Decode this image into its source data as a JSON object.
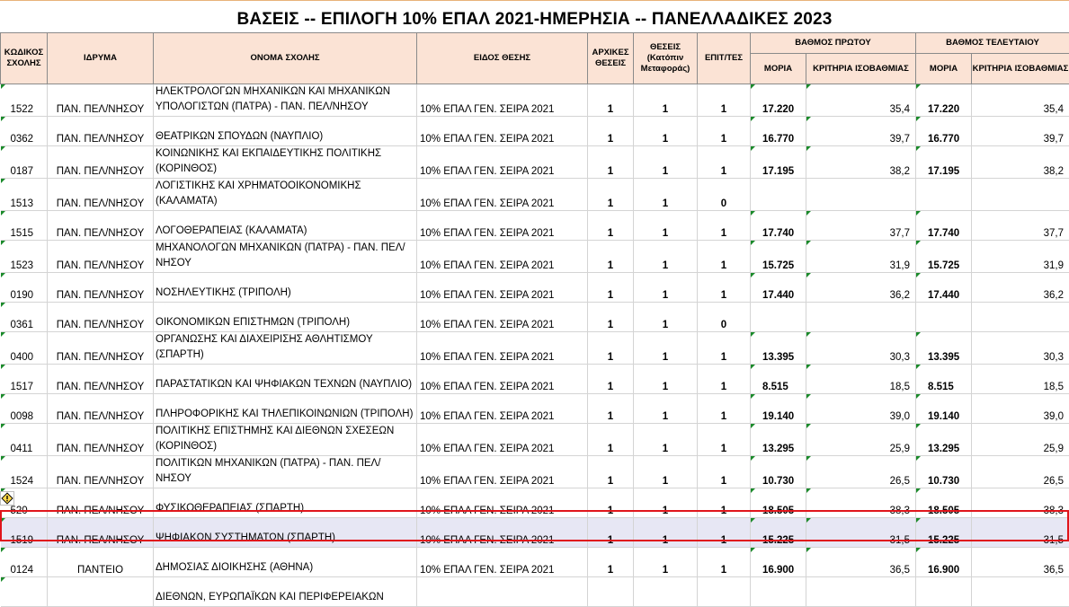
{
  "title": "ΒΑΣΕΙΣ -- ΕΠΙΛΟΓΗ 10% ΕΠΑΛ 2021-ΗΜΕΡΗΣΙΑ -- ΠΑΝΕΛΛΑΔΙΚΕΣ 2023",
  "headers": {
    "code": "ΚΩΔΙΚΟΣ ΣΧΟΛΗΣ",
    "institution": "ΙΔΡΥΜΑ",
    "school": "ΟΝΟΜΑ ΣΧΟΛΗΣ",
    "type": "ΕΙΔΟΣ ΘΕΣΗΣ",
    "initial": "ΑΡΧΙΚΕΣ ΘΕΣΕΙΣ",
    "after": "ΘΕΣΕΙΣ (Κατόπιν Μεταφοράς)",
    "passed": "ΕΠΙΤ/ΤΕΣ",
    "first_group": "ΒΑΘΜΟΣ ΠΡΩΤΟΥ",
    "last_group": "ΒΑΘΜΟΣ ΤΕΛΕΥΤΑΙΟΥ",
    "moria": "ΜΟΡΙΑ",
    "criteria": "ΚΡΙΤΗΡΙΑ ΙΣΟΒΑΘΜΙΑΣ"
  },
  "rows": [
    {
      "code": "1522",
      "inst": "ΠΑΝ. ΠΕΛ/ΝΗΣΟΥ",
      "name": "ΗΛΕΚΤΡΟΛΟΓΩΝ ΜΗΧΑΝΙΚΩΝ ΚΑΙ ΜΗΧΑΝΙΚΩΝ ΥΠΟΛΟΓΙΣΤΩΝ (ΠΑΤΡΑ) - ΠΑΝ. ΠΕΛ/ΝΗΣΟΥ",
      "type": "10% ΕΠΑΛ ΓΕΝ. ΣΕΙΡΑ 2021",
      "initial": "1",
      "after": "1",
      "passed": "1",
      "m1": "17.220",
      "c1": "35,4",
      "m2": "17.220",
      "c2": "35,4"
    },
    {
      "code": "0362",
      "inst": "ΠΑΝ. ΠΕΛ/ΝΗΣΟΥ",
      "name": "ΘΕΑΤΡΙΚΩΝ ΣΠΟΥΔΩΝ (ΝΑΥΠΛΙΟ)",
      "type": "10% ΕΠΑΛ ΓΕΝ. ΣΕΙΡΑ 2021",
      "initial": "1",
      "after": "1",
      "passed": "1",
      "m1": "16.770",
      "c1": "39,7",
      "m2": "16.770",
      "c2": "39,7"
    },
    {
      "code": "0187",
      "inst": "ΠΑΝ. ΠΕΛ/ΝΗΣΟΥ",
      "name": "ΚΟΙΝΩΝΙΚΗΣ ΚΑΙ ΕΚΠΑΙΔΕΥΤΙΚΗΣ ΠΟΛΙΤΙΚΗΣ (ΚΟΡΙΝΘΟΣ)",
      "type": "10% ΕΠΑΛ ΓΕΝ. ΣΕΙΡΑ 2021",
      "initial": "1",
      "after": "1",
      "passed": "1",
      "m1": "17.195",
      "c1": "38,2",
      "m2": "17.195",
      "c2": "38,2"
    },
    {
      "code": "1513",
      "inst": "ΠΑΝ. ΠΕΛ/ΝΗΣΟΥ",
      "name": "ΛΟΓΙΣΤΙΚΗΣ ΚΑΙ ΧΡΗΜΑΤΟΟΙΚΟΝΟΜΙΚΗΣ (ΚΑΛΑΜΑΤΑ)",
      "type": "10% ΕΠΑΛ ΓΕΝ. ΣΕΙΡΑ 2021",
      "initial": "1",
      "after": "1",
      "passed": "0",
      "m1": "",
      "c1": "",
      "m2": "",
      "c2": ""
    },
    {
      "code": "1515",
      "inst": "ΠΑΝ. ΠΕΛ/ΝΗΣΟΥ",
      "name": "ΛΟΓΟΘΕΡΑΠΕΙΑΣ (ΚΑΛΑΜΑΤΑ)",
      "type": "10% ΕΠΑΛ ΓΕΝ. ΣΕΙΡΑ 2021",
      "initial": "1",
      "after": "1",
      "passed": "1",
      "m1": "17.740",
      "c1": "37,7",
      "m2": "17.740",
      "c2": "37,7"
    },
    {
      "code": "1523",
      "inst": "ΠΑΝ. ΠΕΛ/ΝΗΣΟΥ",
      "name": "ΜΗΧΑΝΟΛΟΓΩΝ ΜΗΧΑΝΙΚΩΝ (ΠΑΤΡΑ) - ΠΑΝ. ΠΕΛ/ΝΗΣΟΥ",
      "type": "10% ΕΠΑΛ ΓΕΝ. ΣΕΙΡΑ 2021",
      "initial": "1",
      "after": "1",
      "passed": "1",
      "m1": "15.725",
      "c1": "31,9",
      "m2": "15.725",
      "c2": "31,9"
    },
    {
      "code": "0190",
      "inst": "ΠΑΝ. ΠΕΛ/ΝΗΣΟΥ",
      "name": "ΝΟΣΗΛΕΥΤΙΚΗΣ (ΤΡΙΠΟΛΗ)",
      "type": "10% ΕΠΑΛ ΓΕΝ. ΣΕΙΡΑ 2021",
      "initial": "1",
      "after": "1",
      "passed": "1",
      "m1": "17.440",
      "c1": "36,2",
      "m2": "17.440",
      "c2": "36,2"
    },
    {
      "code": "0361",
      "inst": "ΠΑΝ. ΠΕΛ/ΝΗΣΟΥ",
      "name": "ΟΙΚΟΝΟΜΙΚΩΝ ΕΠΙΣΤΗΜΩΝ (ΤΡΙΠΟΛΗ)",
      "type": "10% ΕΠΑΛ ΓΕΝ. ΣΕΙΡΑ 2021",
      "initial": "1",
      "after": "1",
      "passed": "0",
      "m1": "",
      "c1": "",
      "m2": "",
      "c2": ""
    },
    {
      "code": "0400",
      "inst": "ΠΑΝ. ΠΕΛ/ΝΗΣΟΥ",
      "name": "ΟΡΓΑΝΩΣΗΣ ΚΑΙ ΔΙΑΧΕΙΡΙΣΗΣ ΑΘΛΗΤΙΣΜΟΥ (ΣΠΑΡΤΗ)",
      "type": "10% ΕΠΑΛ ΓΕΝ. ΣΕΙΡΑ 2021",
      "initial": "1",
      "after": "1",
      "passed": "1",
      "m1": "13.395",
      "c1": "30,3",
      "m2": "13.395",
      "c2": "30,3"
    },
    {
      "code": "1517",
      "inst": "ΠΑΝ. ΠΕΛ/ΝΗΣΟΥ",
      "name": "ΠΑΡΑΣΤΑΤΙΚΩΝ ΚΑΙ ΨΗΦΙΑΚΩΝ ΤΕΧΝΩΝ (ΝΑΥΠΛΙΟ)",
      "type": "10% ΕΠΑΛ ΓΕΝ. ΣΕΙΡΑ 2021",
      "initial": "1",
      "after": "1",
      "passed": "1",
      "m1": "8.515",
      "c1": "18,5",
      "m2": "8.515",
      "c2": "18,5"
    },
    {
      "code": "0098",
      "inst": "ΠΑΝ. ΠΕΛ/ΝΗΣΟΥ",
      "name": "ΠΛΗΡΟΦΟΡΙΚΗΣ ΚΑΙ ΤΗΛΕΠΙΚΟΙΝΩΝΙΩΝ (ΤΡΙΠΟΛΗ)",
      "type": "10% ΕΠΑΛ ΓΕΝ. ΣΕΙΡΑ 2021",
      "initial": "1",
      "after": "1",
      "passed": "1",
      "m1": "19.140",
      "c1": "39,0",
      "m2": "19.140",
      "c2": "39,0"
    },
    {
      "code": "0411",
      "inst": "ΠΑΝ. ΠΕΛ/ΝΗΣΟΥ",
      "name": "ΠΟΛΙΤΙΚΗΣ ΕΠΙΣΤΗΜΗΣ ΚΑΙ ΔΙΕΘΝΩΝ ΣΧΕΣΕΩΝ (ΚΟΡΙΝΘΟΣ)",
      "type": "10% ΕΠΑΛ ΓΕΝ. ΣΕΙΡΑ 2021",
      "initial": "1",
      "after": "1",
      "passed": "1",
      "m1": "13.295",
      "c1": "25,9",
      "m2": "13.295",
      "c2": "25,9"
    },
    {
      "code": "1524",
      "inst": "ΠΑΝ. ΠΕΛ/ΝΗΣΟΥ",
      "name": "ΠΟΛΙΤΙΚΩΝ ΜΗΧΑΝΙΚΩΝ (ΠΑΤΡΑ) - ΠΑΝ. ΠΕΛ/ΝΗΣΟΥ",
      "type": "10% ΕΠΑΛ ΓΕΝ. ΣΕΙΡΑ 2021",
      "initial": "1",
      "after": "1",
      "passed": "1",
      "m1": "10.730",
      "c1": "26,5",
      "m2": "10.730",
      "c2": "26,5"
    },
    {
      "code": "520",
      "inst": "ΠΑΝ. ΠΕΛ/ΝΗΣΟΥ",
      "name": "ΦΥΣΙΚΟΘΕΡΑΠΕΙΑΣ (ΣΠΑΡΤΗ)",
      "type": "10% ΕΠΑΛ ΓΕΝ. ΣΕΙΡΑ 2021",
      "initial": "1",
      "after": "1",
      "passed": "1",
      "m1": "18.505",
      "c1": "38,3",
      "m2": "18.505",
      "c2": "38,3"
    },
    {
      "code": "1519",
      "inst": "ΠΑΝ. ΠΕΛ/ΝΗΣΟΥ",
      "name": "ΨΗΦΙΑΚΩΝ ΣΥΣΤΗΜΑΤΩΝ (ΣΠΑΡΤΗ)",
      "type": "10% ΕΠΑΛ ΓΕΝ. ΣΕΙΡΑ 2021",
      "initial": "1",
      "after": "1",
      "passed": "1",
      "m1": "15.225",
      "c1": "31,5",
      "m2": "15.225",
      "c2": "31,5"
    },
    {
      "code": "0124",
      "inst": "ΠΑΝΤΕΙΟ",
      "name": "ΔΗΜΟΣΙΑΣ ΔΙΟΙΚΗΣΗΣ (ΑΘΗΝΑ)",
      "type": "10% ΕΠΑΛ ΓΕΝ. ΣΕΙΡΑ 2021",
      "initial": "1",
      "after": "1",
      "passed": "1",
      "m1": "16.900",
      "c1": "36,5",
      "m2": "16.900",
      "c2": "36,5"
    },
    {
      "code": "",
      "inst": "",
      "name": "ΔΙΕΘΝΩΝ, ΕΥΡΩΠΑΪΚΩΝ ΚΑΙ ΠΕΡΙΦΕΡΕΙΑΚΩΝ",
      "type": "",
      "initial": "",
      "after": "",
      "passed": "",
      "m1": "",
      "c1": "",
      "m2": "",
      "c2": ""
    }
  ],
  "selected_row_index": 14,
  "colors": {
    "header_bg": "#fbe3d5",
    "selection_border": "#e0151b",
    "selected_row_bg": "#e7e7f4",
    "comment_marker": "#1a8a2a"
  },
  "icons": {
    "error_indicator": "warning-diamond-icon"
  }
}
